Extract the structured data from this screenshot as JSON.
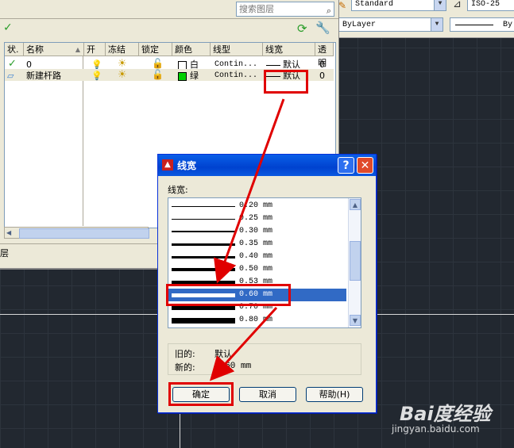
{
  "toolbar": {
    "text_style": "Standard",
    "dim_style": "ISO-25",
    "layer_linetype": "ByLayer",
    "layer_lineweight": "By"
  },
  "panel": {
    "search_placeholder": "搜索图层",
    "columns": [
      "状.",
      "名称",
      "开",
      "冻结",
      "锁定",
      "颜色",
      "线型",
      "线宽",
      "透明"
    ],
    "rows": [
      {
        "name": "0",
        "color": "白",
        "color_hex": "#ffffff",
        "linetype": "Contin...",
        "lineweight": "默认",
        "transparency": "0"
      },
      {
        "name": "新建杆路",
        "color": "绿",
        "color_hex": "#00d000",
        "linetype": "Contin...",
        "lineweight": "默认",
        "transparency": "0"
      }
    ],
    "status": "层"
  },
  "dialog": {
    "title": "线宽",
    "list_label": "线宽:",
    "items": [
      {
        "label": "0.20 mm",
        "weight": 1
      },
      {
        "label": "0.25 mm",
        "weight": 1
      },
      {
        "label": "0.30 mm",
        "weight": 2
      },
      {
        "label": "0.35 mm",
        "weight": 3
      },
      {
        "label": "0.40 mm",
        "weight": 3
      },
      {
        "label": "0.50 mm",
        "weight": 4
      },
      {
        "label": "0.53 mm",
        "weight": 4
      },
      {
        "label": "0.60 mm",
        "weight": 5
      },
      {
        "label": "0.70 mm",
        "weight": 6
      },
      {
        "label": "0.80 mm",
        "weight": 7
      }
    ],
    "selected_index": 7,
    "old_label": "旧的:",
    "old_value": "默认",
    "new_label": "新的:",
    "new_value": "0.60 mm",
    "ok_label": "确定",
    "cancel_label": "取消",
    "help_label": "帮助(H)"
  },
  "colors": {
    "annotation": "#e00000",
    "selection": "#316ac5",
    "title_bar": "#0042cf"
  },
  "watermark": {
    "logo": "Bai度经验",
    "url": "jingyan.baidu.com"
  }
}
